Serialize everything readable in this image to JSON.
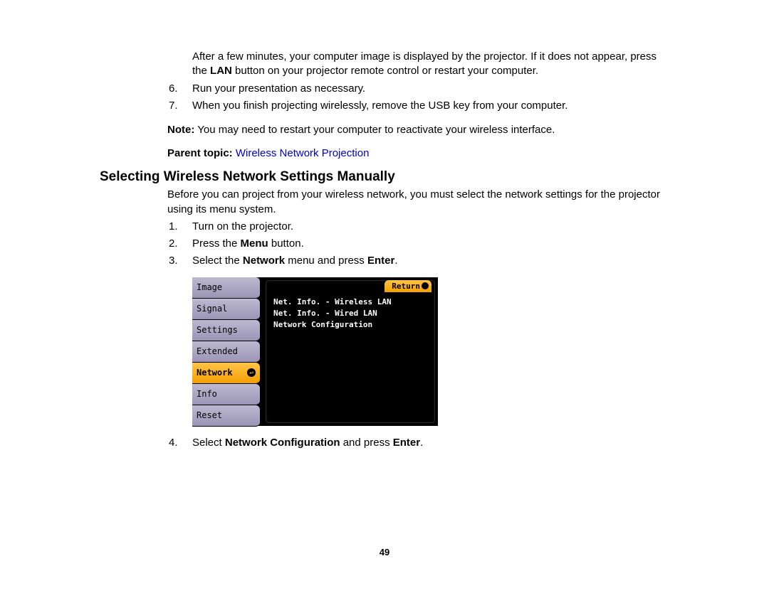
{
  "para1_a": "After a few minutes, your computer image is displayed by the projector. If it does not appear, press the ",
  "para1_b": "LAN",
  "para1_c": " button on your projector remote control or restart your computer.",
  "step6_num": "6.",
  "step6": "Run your presentation as necessary.",
  "step7_num": "7.",
  "step7": "When you finish projecting wirelessly, remove the USB key from your computer.",
  "note_label": "Note:",
  "note_text": " You may need to restart your computer to reactivate your wireless interface.",
  "parent_label": "Parent topic: ",
  "parent_link": "Wireless Network Projection",
  "heading": "Selecting Wireless Network Settings Manually",
  "intro": "Before you can project from your wireless network, you must select the network settings for the projector using its menu system.",
  "s1_num": "1.",
  "s1": "Turn on the projector.",
  "s2_num": "2.",
  "s2_a": "Press the ",
  "s2_b": "Menu",
  "s2_c": " button.",
  "s3_num": "3.",
  "s3_a": "Select the ",
  "s3_b": "Network",
  "s3_c": " menu and press ",
  "s3_d": "Enter",
  "s3_e": ".",
  "s4_num": "4.",
  "s4_a": "Select ",
  "s4_b": "Network Configuration",
  "s4_c": " and press ",
  "s4_d": "Enter",
  "s4_e": ".",
  "menu": {
    "tabs": [
      "Image",
      "Signal",
      "Settings",
      "Extended",
      "Network",
      "Info",
      "Reset"
    ],
    "active": "Network",
    "return": "Return",
    "lines": [
      "Net. Info. - Wireless LAN",
      "Net. Info. - Wired LAN",
      "Network Configuration"
    ]
  },
  "page_number": "49"
}
